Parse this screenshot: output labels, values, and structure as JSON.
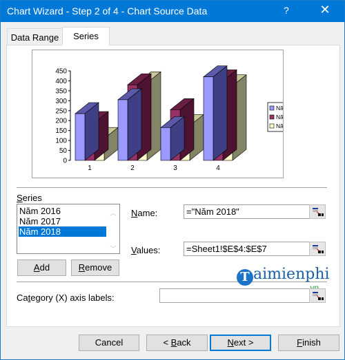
{
  "window": {
    "title": "Chart Wizard - Step 2 of 4 - Chart Source Data",
    "help_label": "?",
    "close_label": "✕"
  },
  "tabs": [
    {
      "label": "Data Range",
      "active": false
    },
    {
      "label": "Series",
      "active": true
    }
  ],
  "chart_data": {
    "type": "bar",
    "subtype": "3d-clustered-column",
    "title": "",
    "xlabel": "",
    "ylabel": "",
    "categories": [
      "1",
      "2",
      "3",
      "4"
    ],
    "series": [
      {
        "name": "Năm 2016",
        "color": "#9999ff",
        "values": [
          235,
          305,
          165,
          420
        ]
      },
      {
        "name": "Năm 2017",
        "color": "#993366",
        "values": [
          190,
          380,
          255,
          400
        ]
      },
      {
        "name": "Năm 2018",
        "color": "#ffffcc",
        "values": [
          110,
          390,
          175,
          375
        ]
      }
    ],
    "ylim": [
      0,
      450
    ],
    "yticks": [
      0,
      50,
      100,
      150,
      200,
      250,
      300,
      350,
      400,
      450
    ],
    "grid": false,
    "legend": "right"
  },
  "series_section": {
    "label": "Series",
    "items": [
      "Năm 2016",
      "Năm 2017",
      "Năm 2018"
    ],
    "selected": "Năm 2018",
    "scroll_up": "︿",
    "scroll_down": "﹀",
    "add_label": "Add",
    "remove_label": "Remove"
  },
  "name_field": {
    "label": "Name:",
    "value": "=\"Năm 2018\""
  },
  "values_field": {
    "label": "Values:",
    "value": "=Sheet1!$E$4:$E$7"
  },
  "category_field": {
    "label": "Category (X) axis labels:",
    "value": ""
  },
  "footer": {
    "cancel_label": "Cancel",
    "back_label": "< Back",
    "next_label": "Next >",
    "finish_label": "Finish"
  },
  "watermark": {
    "brand": "aimienphi",
    "brand_initial": "T",
    "suffix": ".vn"
  }
}
